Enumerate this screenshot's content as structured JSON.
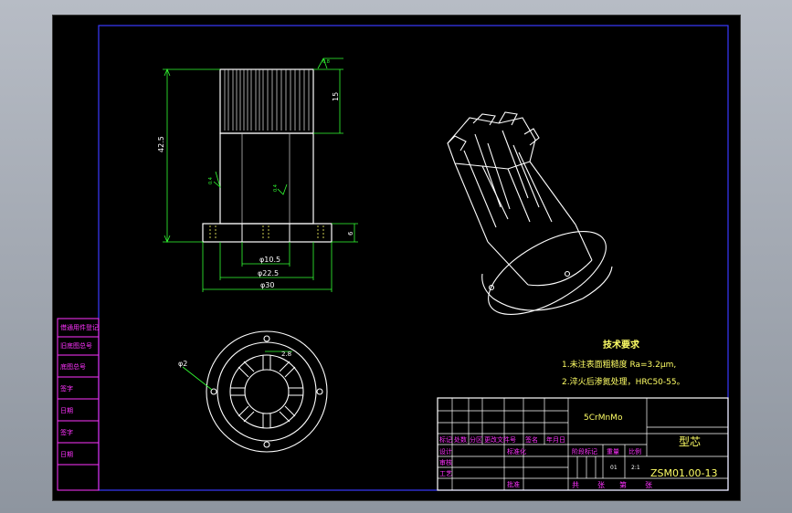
{
  "drawing": {
    "part_name": "型芯",
    "drawing_number": "ZSM01.00-13",
    "material": "5CrMnMo",
    "scale_value": "2:1",
    "weight_value": "01"
  },
  "technical_requirements": {
    "title": "技术要求",
    "items": [
      "1.未注表面粗糙度 Ra=3.2μm,",
      "2.淬火后渗氮处理，HRC50-55。"
    ]
  },
  "dimensions": {
    "total_height": "42.5",
    "teeth_height": "15",
    "flange_thickness": "6",
    "dia_inner": "φ10.5",
    "dia_mid": "φ22.5",
    "dia_outer": "φ30",
    "hole_dia": "φ2",
    "tooth_width": "2.8",
    "roughness_top": "0.8",
    "roughness_a": "0.4",
    "roughness_b": "0.4"
  },
  "title_block": {
    "header_row": [
      "标记",
      "处数",
      "分区",
      "更改文件号",
      "签名",
      "年月日"
    ],
    "labels": {
      "design": "设计",
      "standardization": "标准化",
      "review": "审核",
      "process": "工艺",
      "approve": "批准",
      "stage_mark": "阶段标记",
      "weight": "重量",
      "scale": "比例",
      "total_sheets": "共",
      "sheet_unit": "张",
      "sheet_no": "第",
      "sheet_unit2": "张"
    }
  },
  "side_table": {
    "items": [
      "借通用件登记",
      "旧底图总号",
      "底图总号",
      "签字",
      "日期",
      "签字",
      "日期"
    ]
  }
}
